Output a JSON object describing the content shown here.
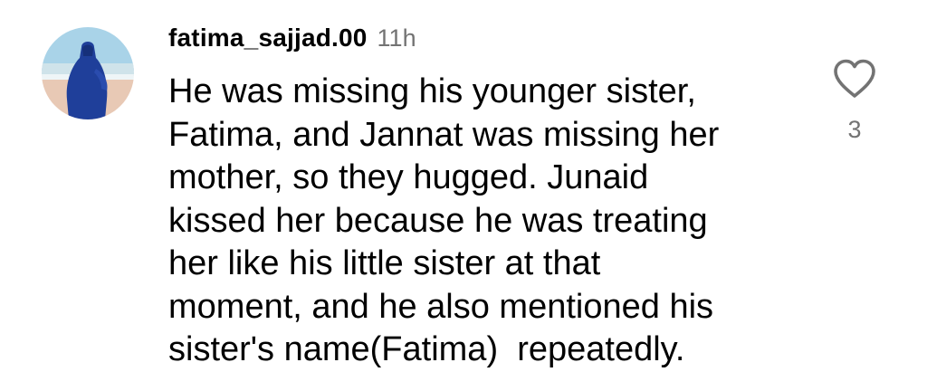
{
  "comment": {
    "username": "fatima_sajjad.00",
    "timestamp": "11h",
    "text_lines": [
      "He was missing his younger sister,",
      "Fatima, and Jannat was missing her",
      "mother, so they hugged. Junaid",
      "kissed her because he was treating",
      "her like his little sister at that",
      "moment, and he also mentioned his",
      "sister's name(Fatima)  repeatedly."
    ],
    "like_icon": "heart-outline-icon",
    "like_count": "3"
  },
  "colors": {
    "text": "#000000",
    "secondary_text": "#737373",
    "avatar_sky": "#a9d3e8",
    "avatar_sea": "#cfe3ea",
    "avatar_sand": "#e8c9b5",
    "avatar_figure": "#1f3f9a"
  }
}
